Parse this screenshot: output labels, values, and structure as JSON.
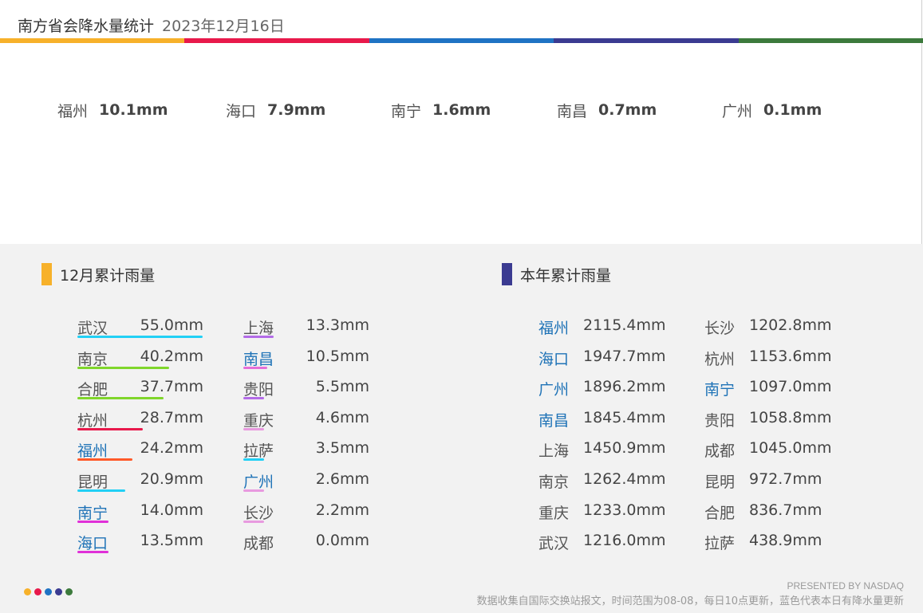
{
  "header": {
    "title": "南方省会降水量统计",
    "date": "2023年12月16日"
  },
  "stripe_colors": [
    "#f7b12a",
    "#e8194b",
    "#1f73c4",
    "#3b3b91",
    "#3c7a3c"
  ],
  "today": [
    {
      "city": "福州",
      "value": "10.1mm"
    },
    {
      "city": "海口",
      "value": "7.9mm"
    },
    {
      "city": "南宁",
      "value": "1.6mm"
    },
    {
      "city": "南昌",
      "value": "0.7mm"
    },
    {
      "city": "广州",
      "value": "0.1mm"
    }
  ],
  "monthly": {
    "title": "12月累计雨量",
    "accent": "#f7b12a",
    "col1": [
      {
        "city": "武汉",
        "value": "55.0mm",
        "blue": false,
        "color": "#22d0f5",
        "level": 1.0
      },
      {
        "city": "南京",
        "value": "40.2mm",
        "blue": false,
        "color": "#80d62b",
        "level": 0.73
      },
      {
        "city": "合肥",
        "value": "37.7mm",
        "blue": false,
        "color": "#80d62b",
        "level": 0.69
      },
      {
        "city": "杭州",
        "value": "28.7mm",
        "blue": false,
        "color": "#e8194b",
        "level": 0.52
      },
      {
        "city": "福州",
        "value": "24.2mm",
        "blue": true,
        "color": "#ff5a2a",
        "level": 0.44
      },
      {
        "city": "昆明",
        "value": "20.9mm",
        "blue": false,
        "color": "#22d0f5",
        "level": 0.38
      },
      {
        "city": "南宁",
        "value": "14.0mm",
        "blue": true,
        "color": "#e030d8",
        "level": 0.25
      },
      {
        "city": "海口",
        "value": "13.5mm",
        "blue": true,
        "color": "#e030d8",
        "level": 0.25
      }
    ],
    "col2": [
      {
        "city": "上海",
        "value": "13.3mm",
        "blue": false,
        "color": "#b36be8",
        "level": 0.24
      },
      {
        "city": "南昌",
        "value": "10.5mm",
        "blue": true,
        "color": "#e66fd8",
        "level": 0.19
      },
      {
        "city": "贵阳",
        "value": "5.5mm",
        "blue": false,
        "color": "#b36be8",
        "level": 0.1
      },
      {
        "city": "重庆",
        "value": "4.6mm",
        "blue": false,
        "color": "#e89adf",
        "level": 0.08
      },
      {
        "city": "拉萨",
        "value": "3.5mm",
        "blue": false,
        "color": "#22d0f5",
        "level": 0.06
      },
      {
        "city": "广州",
        "value": "2.6mm",
        "blue": true,
        "color": "#e89adf",
        "level": 0.05
      },
      {
        "city": "长沙",
        "value": "2.2mm",
        "blue": false,
        "color": "#e89adf",
        "level": 0.04
      },
      {
        "city": "成都",
        "value": "0.0mm",
        "blue": false,
        "color": "#e89adf",
        "level": 0.0
      }
    ]
  },
  "yearly": {
    "title": "本年累计雨量",
    "accent": "#3b3b91",
    "col1": [
      {
        "city": "福州",
        "value": "2115.4mm",
        "blue": true
      },
      {
        "city": "海口",
        "value": "1947.7mm",
        "blue": true
      },
      {
        "city": "广州",
        "value": "1896.2mm",
        "blue": true
      },
      {
        "city": "南昌",
        "value": "1845.4mm",
        "blue": true
      },
      {
        "city": "上海",
        "value": "1450.9mm",
        "blue": false
      },
      {
        "city": "南京",
        "value": "1262.4mm",
        "blue": false
      },
      {
        "city": "重庆",
        "value": "1233.0mm",
        "blue": false
      },
      {
        "city": "武汉",
        "value": "1216.0mm",
        "blue": false
      }
    ],
    "col2": [
      {
        "city": "长沙",
        "value": "1202.8mm",
        "blue": false
      },
      {
        "city": "杭州",
        "value": "1153.6mm",
        "blue": false
      },
      {
        "city": "南宁",
        "value": "1097.0mm",
        "blue": true
      },
      {
        "city": "贵阳",
        "value": "1058.8mm",
        "blue": false
      },
      {
        "city": "成都",
        "value": "1045.0mm",
        "blue": false
      },
      {
        "city": "昆明",
        "value": "972.7mm",
        "blue": false
      },
      {
        "city": "合肥",
        "value": "836.7mm",
        "blue": false
      },
      {
        "city": "拉萨",
        "value": "438.9mm",
        "blue": false
      }
    ]
  },
  "footer": {
    "presented": "PRESENTED BY NASDAQ",
    "note": "数据收集自国际交换站报文，时间范围为08-08，每日10点更新，蓝色代表本日有降水量更新"
  },
  "dot_colors": [
    "#f7b12a",
    "#e8194b",
    "#1f73c4",
    "#3b3b91",
    "#3c7a3c"
  ]
}
